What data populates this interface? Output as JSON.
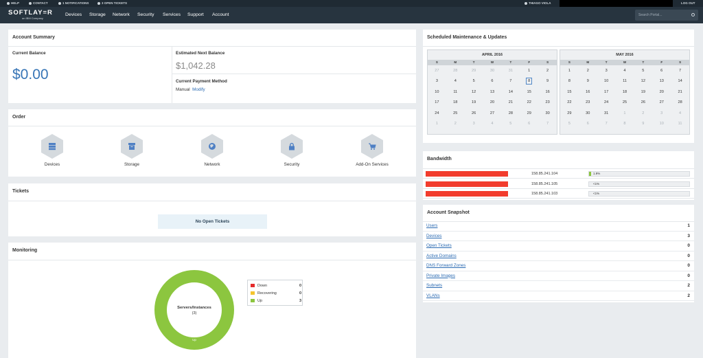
{
  "topbar": {
    "help": "HELP",
    "contact": "CONTACT",
    "notifications": "1 NOTIFICATIONS",
    "tickets": "3 OPEN TICKETS",
    "user": "THIAGO VIOLA",
    "logout": "LOG OUT"
  },
  "brand": {
    "name": "SOFTLAY=R",
    "sub": "an IBM Company"
  },
  "nav": [
    "Devices",
    "Storage",
    "Network",
    "Security",
    "Services",
    "Support",
    "Account"
  ],
  "search": {
    "placeholder": "Search Portal..."
  },
  "account_summary": {
    "title": "Account Summary",
    "current_balance_label": "Current Balance",
    "current_balance": "$0.00",
    "est_label": "Estimated Next Balance",
    "est_value": "$1,042.28",
    "payment_label": "Current Payment Method",
    "payment_value": "Manual",
    "modify": "Modify"
  },
  "order": {
    "title": "Order",
    "items": [
      {
        "label": "Devices",
        "icon": "server-icon"
      },
      {
        "label": "Storage",
        "icon": "archive-icon"
      },
      {
        "label": "Network",
        "icon": "globe-icon"
      },
      {
        "label": "Security",
        "icon": "lock-icon"
      },
      {
        "label": "Add-On Services",
        "icon": "cart-icon"
      }
    ]
  },
  "tickets": {
    "title": "Tickets",
    "empty": "No Open Tickets"
  },
  "monitoring": {
    "title": "Monitoring",
    "donut_title": "Servers/Instances",
    "donut_count": "(3)",
    "donut_label": "Up",
    "legend": [
      {
        "name": "Down",
        "value": "0",
        "color": "#e52b2b"
      },
      {
        "name": "Recovering",
        "value": "0",
        "color": "#f4c42d"
      },
      {
        "name": "Up",
        "value": "3",
        "color": "#8cc63f"
      }
    ],
    "up_fraction": 1
  },
  "maintenance": {
    "title": "Scheduled Maintenance & Updates",
    "dow": [
      "S",
      "M",
      "T",
      "W",
      "T",
      "F",
      "S"
    ],
    "months": [
      {
        "name": "APRIL 2016",
        "days": [
          "27",
          "28",
          "29",
          "30",
          "31",
          "1",
          "2",
          "3",
          "4",
          "5",
          "6",
          "7",
          "8",
          "9",
          "10",
          "11",
          "12",
          "13",
          "14",
          "15",
          "16",
          "17",
          "18",
          "19",
          "20",
          "21",
          "22",
          "23",
          "24",
          "25",
          "26",
          "27",
          "28",
          "29",
          "30",
          "1",
          "2",
          "3",
          "4",
          "5",
          "6",
          "7"
        ],
        "lead": 5,
        "trail": 7,
        "today": "8"
      },
      {
        "name": "MAY 2016",
        "days": [
          "1",
          "2",
          "3",
          "4",
          "5",
          "6",
          "7",
          "8",
          "9",
          "10",
          "11",
          "12",
          "13",
          "14",
          "15",
          "16",
          "17",
          "18",
          "19",
          "20",
          "21",
          "22",
          "23",
          "24",
          "25",
          "26",
          "27",
          "28",
          "29",
          "30",
          "31",
          "1",
          "2",
          "3",
          "4",
          "5",
          "6",
          "7",
          "8",
          "9",
          "10",
          "11"
        ],
        "lead": 0,
        "trail": 11,
        "today": ""
      }
    ]
  },
  "bandwidth": {
    "title": "Bandwidth",
    "rows": [
      {
        "ip": "158.85.241.104",
        "usage": "1.9%",
        "fill": 0.019
      },
      {
        "ip": "158.85.241.105",
        "usage": "<1%",
        "fill": 0
      },
      {
        "ip": "158.85.241.103",
        "usage": "<1%",
        "fill": 0
      }
    ]
  },
  "snapshot": {
    "title": "Account Snapshot",
    "rows": [
      {
        "label": "Users",
        "count": "1"
      },
      {
        "label": "Devices",
        "count": "3"
      },
      {
        "label": "Open Tickets",
        "count": "0"
      },
      {
        "label": "Active Domains",
        "count": "0"
      },
      {
        "label": "DNS Forward Zones",
        "count": "0"
      },
      {
        "label": "Private Images",
        "count": "0"
      },
      {
        "label": "Subnets",
        "count": "2"
      },
      {
        "label": "VLANs",
        "count": "2"
      }
    ]
  }
}
